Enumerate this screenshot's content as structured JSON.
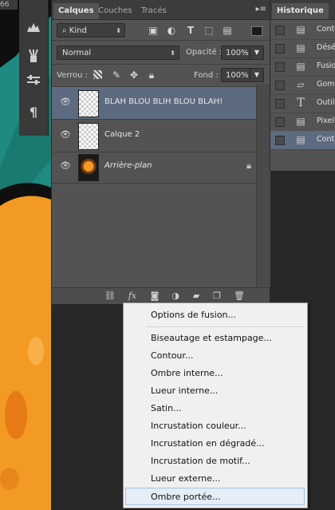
{
  "canvas": {
    "ruler_number": "66"
  },
  "layers_panel": {
    "tabs": [
      "Calques",
      "Couches",
      "Tracés"
    ],
    "filter": {
      "kind_label": "Kind"
    },
    "blend_mode": "Normal",
    "opacity_label": "Opacité :",
    "opacity_value": "100%",
    "lock_label": "Verrou :",
    "fill_label": "Fond :",
    "fill_value": "100%",
    "layers": [
      {
        "name": "BLAH BLOU BLIH BLOU BLAH!",
        "selected": true
      },
      {
        "name": "Calque 2",
        "selected": false
      },
      {
        "name": "Arrière-plan",
        "selected": false,
        "locked": true
      }
    ],
    "fx_label": "fx"
  },
  "history_panel": {
    "tab": "Historique",
    "items": [
      {
        "label": "Conto",
        "icon": "document-icon"
      },
      {
        "label": "Désél",
        "icon": "document-icon"
      },
      {
        "label": "Fusio",
        "icon": "document-icon"
      },
      {
        "label": "Gomm",
        "icon": "eraser-icon"
      },
      {
        "label": "Outil",
        "icon": "type-tool-icon"
      },
      {
        "label": "Pixell",
        "icon": "document-icon"
      },
      {
        "label": "Conto",
        "icon": "document-icon",
        "selected": true
      }
    ]
  },
  "fx_menu": {
    "items": [
      "Options de fusion...",
      "Biseautage et estampage...",
      "Contour...",
      "Ombre interne...",
      "Lueur interne...",
      "Satin...",
      "Incrustation couleur...",
      "Incrustation en dégradé...",
      "Incrustation de motif...",
      "Lueur externe...",
      "Ombre portée..."
    ],
    "highlighted": "Ombre portée..."
  },
  "colors": {
    "canvas_teal": "#1f8a7f",
    "canvas_orange": "#f29a24",
    "selection": "#5d6b80",
    "panel": "#535353"
  }
}
